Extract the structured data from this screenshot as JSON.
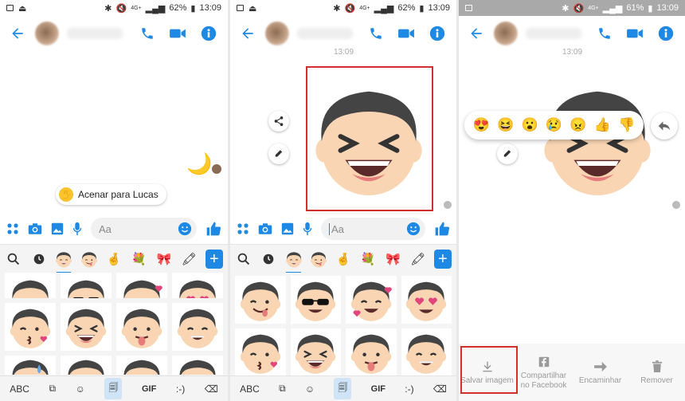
{
  "panel1": {
    "status": {
      "battery": "62%",
      "time": "13:09",
      "net": "4G+"
    },
    "wave_label": "Acenar para Lucas",
    "composer_placeholder": "Aa"
  },
  "panel2": {
    "status": {
      "battery": "62%",
      "time": "13:09",
      "net": "4G+"
    },
    "timestamp": "13:09",
    "composer_placeholder": "Aa"
  },
  "panel3": {
    "status": {
      "battery": "61%",
      "time": "13:09",
      "net": "4G+"
    },
    "timestamp": "13:09",
    "reactions": [
      "😍",
      "😆",
      "😮",
      "😢",
      "😠",
      "👍",
      "👎"
    ],
    "actions": [
      {
        "label": "Salvar imagem"
      },
      {
        "label": "Compartilhar no Facebook"
      },
      {
        "label": "Encaminhar"
      },
      {
        "label": "Remover"
      }
    ]
  },
  "keyboard": {
    "abc": "ABC",
    "gif": "GIF",
    "emoticon": ":-)"
  },
  "colors": {
    "accent": "#1e88e5",
    "highlight": "#d32f2f"
  }
}
